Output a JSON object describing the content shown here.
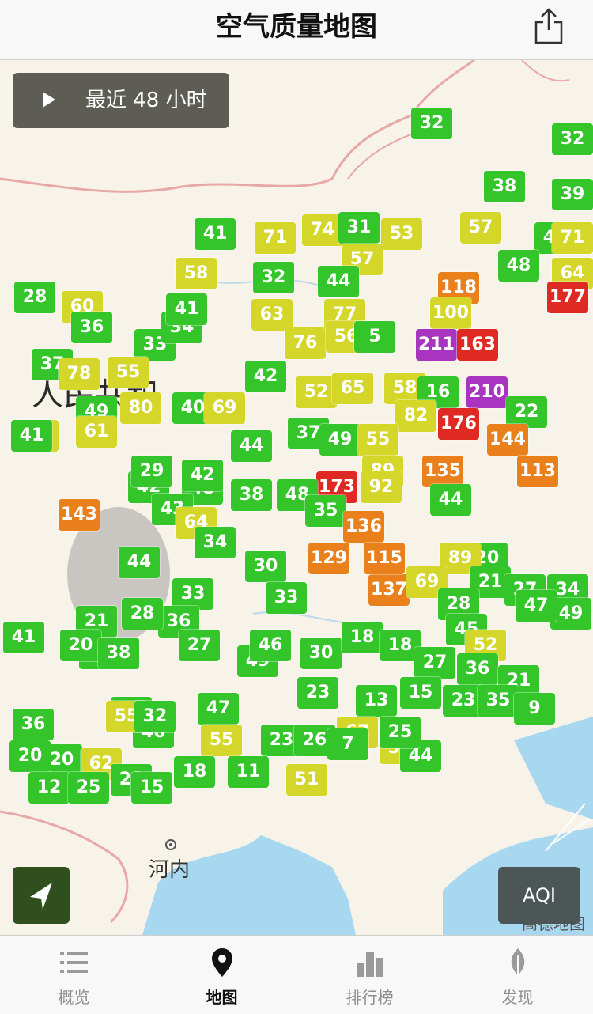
{
  "header": {
    "title": "空气质量地图"
  },
  "controls": {
    "play_label": "最近 48 小时",
    "aqi_label": "AQI",
    "map_credit": "高德地图"
  },
  "map": {
    "city_label": "河内",
    "country_label_partial": "人民共和",
    "visible_aqi_values": [
      32,
      38,
      32,
      39,
      41,
      71,
      74,
      31,
      53,
      57,
      42,
      71,
      58,
      32,
      57,
      44,
      48,
      64,
      28,
      60,
      36,
      33,
      34,
      41,
      63,
      76,
      77,
      56,
      5,
      118,
      100,
      177,
      211,
      163,
      37,
      78,
      55,
      42,
      52,
      65,
      58,
      16,
      210,
      71,
      49,
      80,
      40,
      69,
      82,
      22,
      176,
      144,
      41,
      61,
      42,
      48,
      44,
      37,
      49,
      55,
      89,
      173,
      92,
      135,
      113,
      29,
      42,
      38,
      48,
      43,
      44,
      143,
      64,
      34,
      35,
      136,
      129,
      137,
      115,
      20,
      89,
      21,
      27,
      34,
      44,
      33,
      36,
      69,
      28,
      45,
      52,
      49,
      47,
      30,
      28,
      33,
      21,
      18,
      41,
      20,
      38,
      27,
      49,
      46,
      30,
      18,
      18,
      27,
      36,
      21,
      23,
      35,
      9,
      45,
      46,
      47,
      55,
      23,
      13,
      15,
      36,
      20,
      62,
      55,
      32,
      23,
      26,
      67,
      53,
      44,
      20,
      12,
      25,
      21,
      15,
      18,
      11,
      51,
      7,
      25
    ],
    "color_legend": {
      "good": "#33c52a",
      "moderate": "#d4d62a",
      "usg": "#e9801b",
      "unhealthy": "#de2a22",
      "very_unhealthy": "#a834c0"
    }
  },
  "tabbar": {
    "tabs": [
      {
        "label": "概览"
      },
      {
        "label": "地图"
      },
      {
        "label": "排行榜"
      },
      {
        "label": "发现"
      }
    ],
    "active_index": 1
  }
}
